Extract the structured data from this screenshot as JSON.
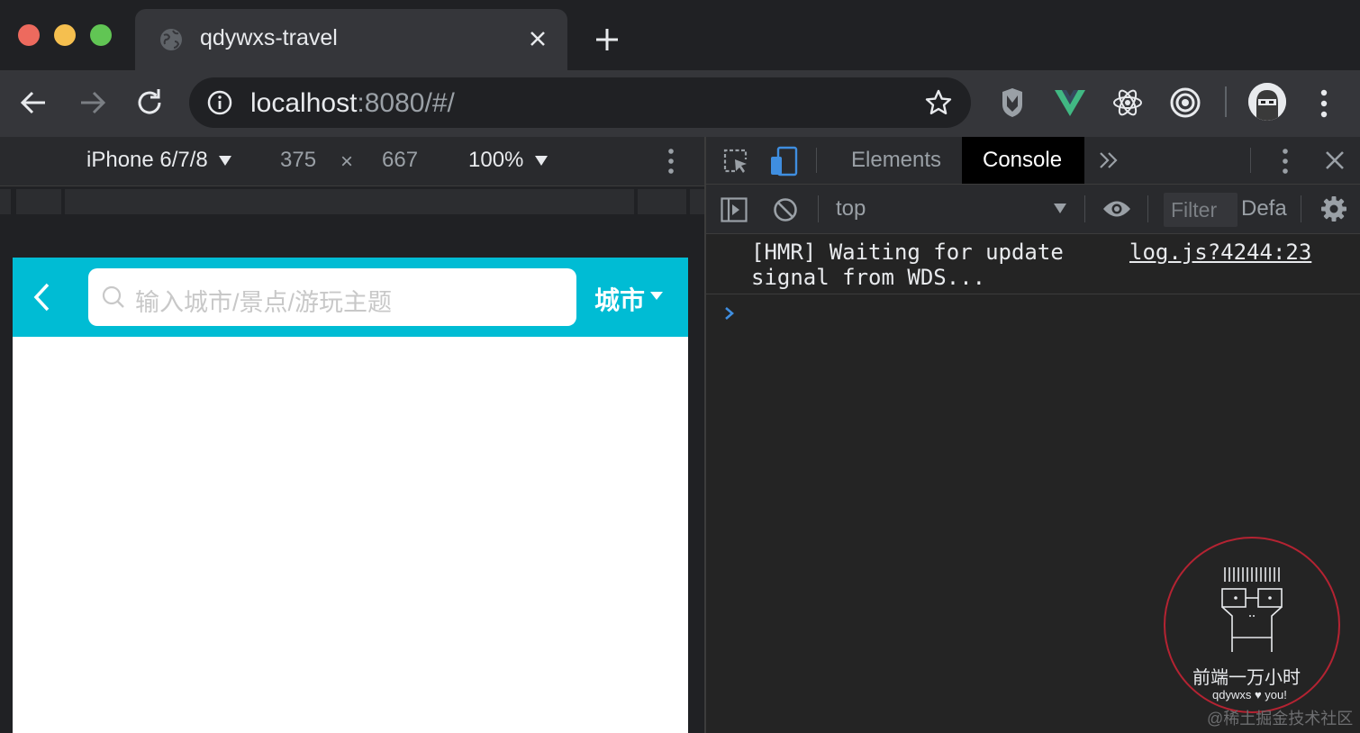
{
  "browser": {
    "tab_title": "qdywxs-travel",
    "url_host": "localhost",
    "url_rest": ":8080/#/",
    "colors": {
      "traffic_red": "#ed6a5e",
      "traffic_yellow": "#f5bf4f",
      "traffic_green": "#61c554",
      "vue_green": "#41b883"
    }
  },
  "device_toolbar": {
    "device": "iPhone 6/7/8",
    "width": "375",
    "times": "×",
    "height": "667",
    "zoom": "100%"
  },
  "app": {
    "search_placeholder": "输入城市/景点/游玩主题",
    "city_label": "城市",
    "header_color": "#00bcd4"
  },
  "devtools": {
    "tabs": {
      "elements": "Elements",
      "console": "Console"
    },
    "context": "top",
    "filter_placeholder": "Filter",
    "levels": "Defa",
    "log": {
      "message": "[HMR] Waiting for update\nsignal from WDS...",
      "source": "log.js?4244:23"
    }
  },
  "watermark": {
    "title": "前端一万小时",
    "subtitle": "qdywxs ♥ you!",
    "site": "@稀土掘金技术社区"
  }
}
